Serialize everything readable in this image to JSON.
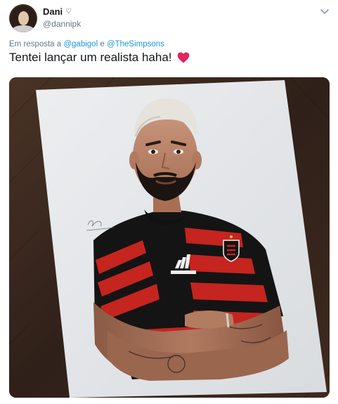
{
  "tweet": {
    "display_name": "Dani",
    "display_name_icon": "heart-outline-icon",
    "handle": "@dannipk",
    "reply_prefix": "Em resposta a",
    "reply_mentions": [
      "@gabigol",
      "@TheSimpsons"
    ],
    "reply_joiner": "e",
    "text": "Tentei lançar um realista haha!",
    "emoji": "red-heart-icon",
    "menu_icon": "chevron-down-icon"
  },
  "colors": {
    "link": "#1b95e0",
    "secondary_text": "#657786",
    "heart": "#e0245e"
  },
  "media": {
    "description_icon": "drawing-photo",
    "artist_signature": "signature-stamp"
  }
}
